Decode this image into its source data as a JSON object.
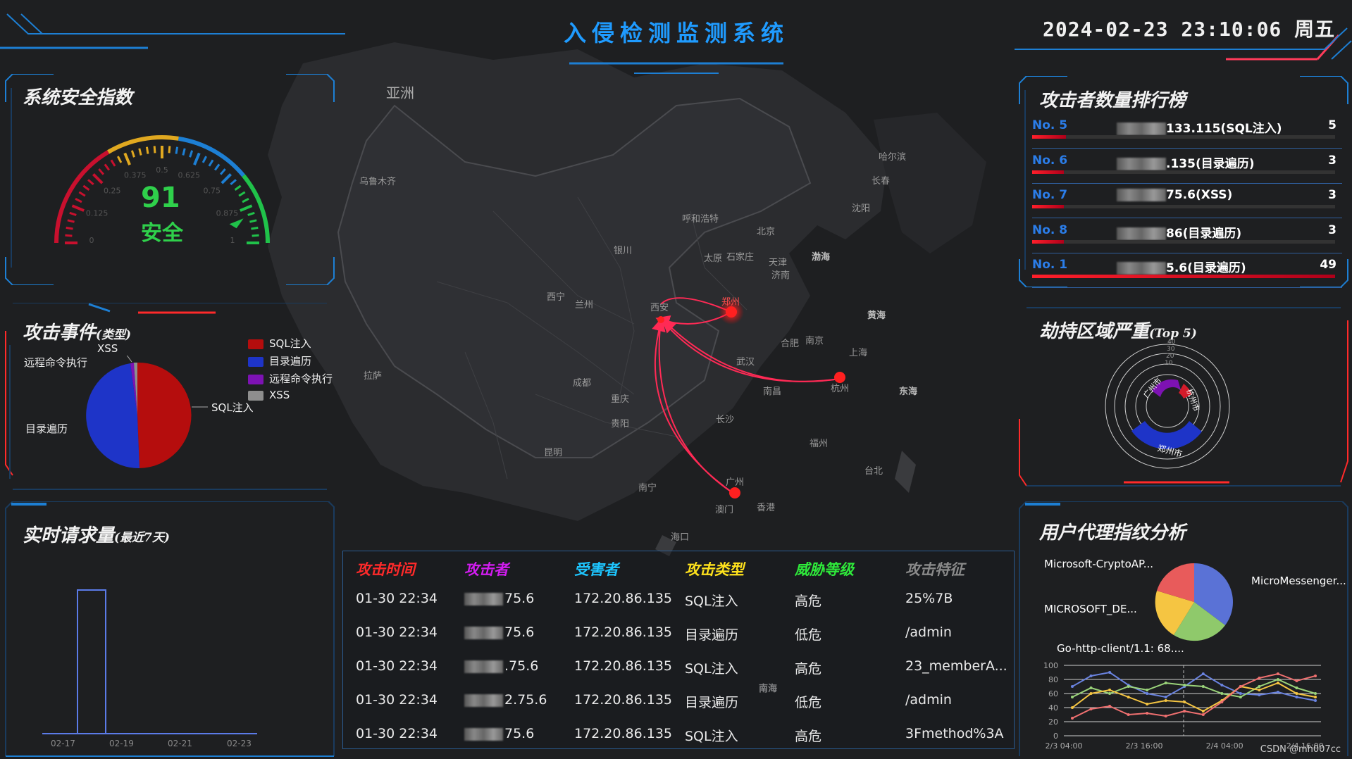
{
  "header": {
    "title": "入侵检测监测系统",
    "datetime": "2024-02-23 23:10:06 周五"
  },
  "security_index": {
    "title": "系统安全指数",
    "score": "91",
    "status": "安全",
    "gauge_value": 91,
    "gauge_max": 100,
    "tick_labels": [
      "0",
      "0.125",
      "0.25",
      "0.375",
      "0.5",
      "0.625",
      "0.75",
      "0.875",
      "1"
    ]
  },
  "attack_events": {
    "title": "攻击事件",
    "title_sub": "(类型)",
    "legend": [
      {
        "label": "SQL注入",
        "color": "#b50d0d"
      },
      {
        "label": "目录遍历",
        "color": "#1e34c8"
      },
      {
        "label": "远程命令执行",
        "color": "#7d12b3"
      },
      {
        "label": "XSS",
        "color": "#8e8e8e"
      }
    ],
    "pie_labels": {
      "xss": "XSS",
      "rce": "远程命令执行",
      "dir": "目录遍历",
      "sql": "SQL注入"
    }
  },
  "requests": {
    "title": "实时请求量",
    "title_sub": "(最近7天)",
    "x_ticks": [
      "02-17",
      "02-19",
      "02-21",
      "02-23"
    ]
  },
  "attacker_ranking": {
    "title": "攻击者数量排行榜",
    "rows": [
      {
        "no": "No. 5",
        "ip_tail": "133.115(SQL注入)",
        "count": "5",
        "ratio": 0.1
      },
      {
        "no": "No. 6",
        "ip_tail": ".135(目录遍历)",
        "count": "3",
        "ratio": 0.061
      },
      {
        "no": "No. 7",
        "ip_tail": "75.6(XSS)",
        "count": "3",
        "ratio": 0.061
      },
      {
        "no": "No. 8",
        "ip_tail": "86(目录遍历)",
        "count": "3",
        "ratio": 0.061
      },
      {
        "no": "No. 1",
        "ip_tail": "5.6(目录遍历)",
        "count": "49",
        "ratio": 1.0
      }
    ]
  },
  "hijack_region": {
    "title": "劫持区域严重",
    "title_sub": "(Top 5)",
    "rings": [
      {
        "label": "郑州市"
      },
      {
        "label": "广州市"
      },
      {
        "label": "杭州市"
      }
    ],
    "ring_ticks": [
      "10",
      "20",
      "30",
      "40"
    ]
  },
  "ua_analysis": {
    "title": "用户代理指纹分析",
    "labels": [
      "Microsoft-CryptoAP...",
      "MicroMessenger...",
      "MICROSOFT_DE...",
      "Go-http-client/1.1: 68...."
    ],
    "y_ticks": [
      "100",
      "80",
      "60",
      "40",
      "20",
      "0"
    ],
    "x_ticks": [
      "2/3 04:00",
      "2/3 16:00",
      "2/4 04:00",
      "2/4 16:00"
    ]
  },
  "map": {
    "cities": [
      {
        "name": "亚洲"
      },
      {
        "name": "乌鲁木齐"
      },
      {
        "name": "哈尔滨"
      },
      {
        "name": "长春"
      },
      {
        "name": "沈阳"
      },
      {
        "name": "呼和浩特"
      },
      {
        "name": "北京"
      },
      {
        "name": "银川"
      },
      {
        "name": "太原"
      },
      {
        "name": "石家庄"
      },
      {
        "name": "天津"
      },
      {
        "name": "济南"
      },
      {
        "name": "西宁"
      },
      {
        "name": "兰州"
      },
      {
        "name": "西安"
      },
      {
        "name": "郑州"
      },
      {
        "name": "合肥"
      },
      {
        "name": "南京"
      },
      {
        "name": "上海"
      },
      {
        "name": "武汉"
      },
      {
        "name": "杭州"
      },
      {
        "name": "拉萨"
      },
      {
        "name": "成都"
      },
      {
        "name": "重庆"
      },
      {
        "name": "南昌"
      },
      {
        "name": "长沙"
      },
      {
        "name": "贵阳"
      },
      {
        "name": "福州"
      },
      {
        "name": "台北"
      },
      {
        "name": "昆明"
      },
      {
        "name": "南宁"
      },
      {
        "name": "广州"
      },
      {
        "name": "澳门"
      },
      {
        "name": "香港"
      },
      {
        "name": "海口"
      }
    ],
    "seas": [
      "渤海",
      "黄海",
      "东海",
      "南海"
    ]
  },
  "attack_table": {
    "headers": [
      {
        "label": "攻击时间",
        "color": "#ff2a2a"
      },
      {
        "label": "攻击者",
        "color": "#d21cf0"
      },
      {
        "label": "受害者",
        "color": "#1ec6ff"
      },
      {
        "label": "攻击类型",
        "color": "#ffe21c"
      },
      {
        "label": "威胁等级",
        "color": "#2ee83a"
      },
      {
        "label": "攻击特征",
        "color": "#8a8a8a"
      }
    ],
    "rows": [
      {
        "time": "01-30 22:34",
        "attacker": "75.6",
        "victim": "172.20.86.135",
        "type": "SQL注入",
        "level": "高危",
        "feature": "25%7B"
      },
      {
        "time": "01-30 22:34",
        "attacker": "75.6",
        "victim": "172.20.86.135",
        "type": "目录遍历",
        "level": "低危",
        "feature": "/admin"
      },
      {
        "time": "01-30 22:34",
        "attacker": ".75.6",
        "victim": "172.20.86.135",
        "type": "SQL注入",
        "level": "高危",
        "feature": "23_memberA..."
      },
      {
        "time": "01-30 22:34",
        "attacker": "2.75.6",
        "victim": "172.20.86.135",
        "type": "目录遍历",
        "level": "低危",
        "feature": "/admin"
      },
      {
        "time": "01-30 22:34",
        "attacker": "75.6",
        "victim": "172.20.86.135",
        "type": "SQL注入",
        "level": "高危",
        "feature": "3Fmethod%3A"
      }
    ]
  },
  "footer": "CSDN @mh007cc"
}
